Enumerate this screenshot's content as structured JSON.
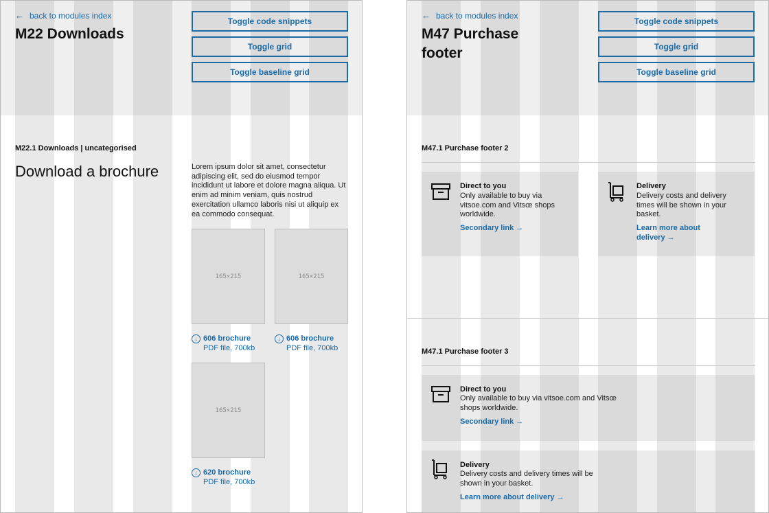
{
  "left": {
    "back_link": "back to modules index",
    "title": "M22 Downloads",
    "buttons": {
      "toggle_code": "Toggle code snippets",
      "toggle_grid": "Toggle grid",
      "toggle_baseline": "Toggle baseline grid"
    },
    "section_label": "M22.1 Downloads | uncategorised",
    "heading": "Download a brochure",
    "body": "Lorem ipsum dolor sit amet, consectetur adipiscing elit, sed do eiusmod tempor incididunt ut labore et dolore magna aliqua. Ut enim ad minim veniam, quis nostrud exercitation ullamco laboris nisi ut aliquip ex ea commodo consequat.",
    "downloads": [
      {
        "thumb": "165×215",
        "title": "606 brochure",
        "meta": "PDF file, 700kb"
      },
      {
        "thumb": "165×215",
        "title": "606 brochure",
        "meta": "PDF file, 700kb"
      },
      {
        "thumb": "165×215",
        "title": "620 brochure",
        "meta": "PDF file, 700kb"
      }
    ]
  },
  "right": {
    "back_link": "back to modules index",
    "title_line1": "M47 Purchase",
    "title_line2": "footer",
    "buttons": {
      "toggle_code": "Toggle code snippets",
      "toggle_grid": "Toggle grid",
      "toggle_baseline": "Toggle baseline grid"
    },
    "footer2": {
      "label": "M47.1 Purchase footer 2",
      "direct": {
        "title": "Direct to you",
        "text": "Only available to buy via vitsoe.com and Vitsœ shops worldwide.",
        "link": "Secondary link →"
      },
      "delivery": {
        "title": "Delivery",
        "text": "Delivery costs and delivery times will be shown in your basket.",
        "link_line1": "Learn more about",
        "link_line2": "delivery →"
      }
    },
    "footer3": {
      "label": "M47.1 Purchase footer 3",
      "direct": {
        "title": "Direct to you",
        "text_line1": "Only available to buy via vitsoe.com and Vitsœ",
        "text_line2": "shops worldwide.",
        "link": "Secondary link →"
      },
      "delivery": {
        "title": "Delivery",
        "text_line1": "Delivery costs and delivery times will be",
        "text_line2": "shown in your basket.",
        "link": "Learn more about delivery →"
      }
    }
  },
  "colors": {
    "accent": "#1a6aa8",
    "header_band": "#efefef",
    "grid_column": "#dcdcdc"
  },
  "icons": {
    "back": "arrow-left-icon",
    "download": "download-circle-icon",
    "box": "box-icon",
    "trolley": "trolley-icon"
  }
}
